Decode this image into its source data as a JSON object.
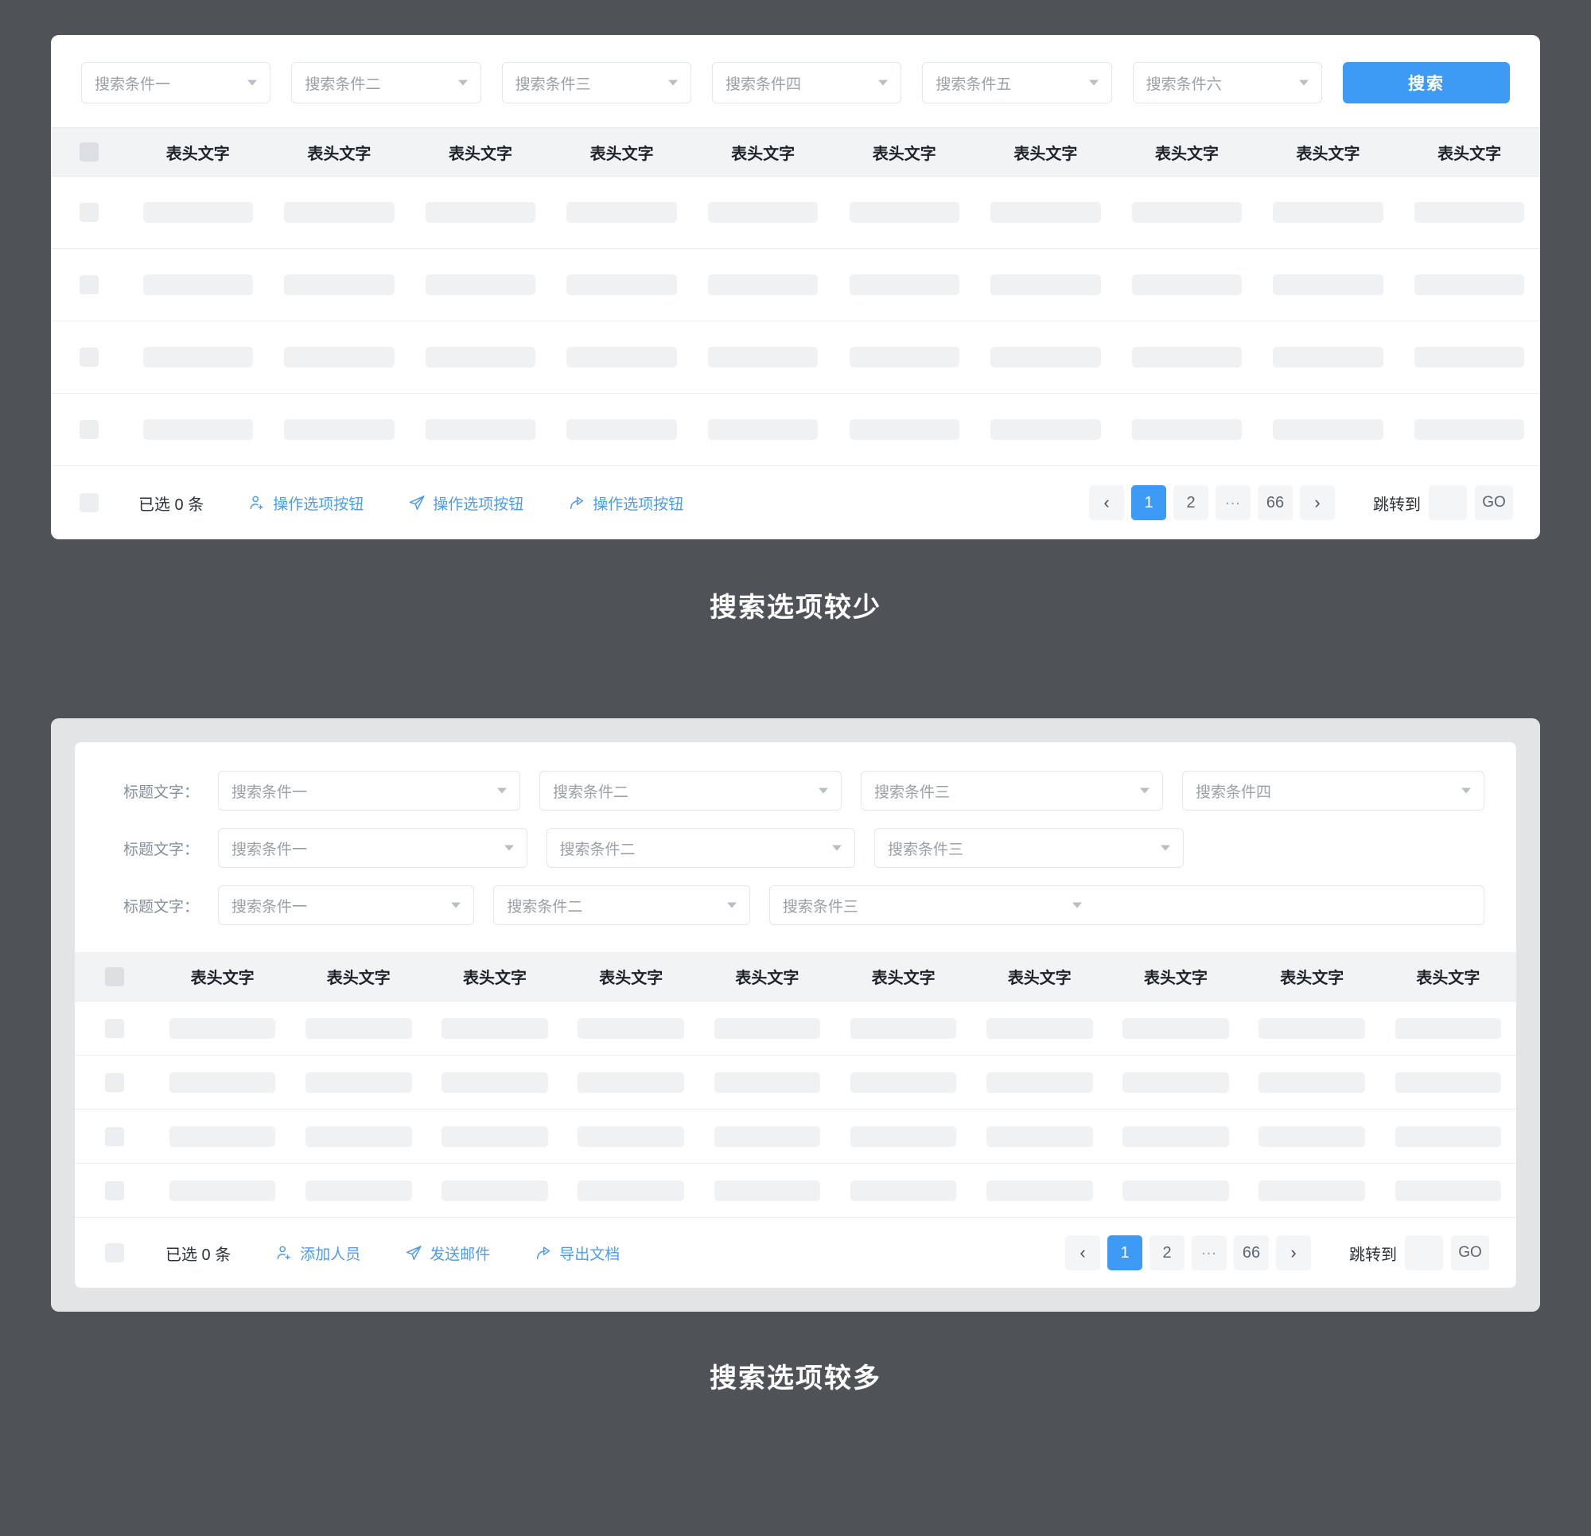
{
  "theme": {
    "page_bg": "#4f5358",
    "accent": "#3d9bf6",
    "link": "#4b9cf0",
    "header_bg": "#f2f3f5",
    "skeleton": "#f0f1f2"
  },
  "card_one": {
    "search_bar": {
      "selects": [
        {
          "value": "搜索条件一"
        },
        {
          "value": "搜索条件二"
        },
        {
          "value": "搜索条件三"
        },
        {
          "value": "搜索条件四"
        },
        {
          "value": "搜索条件五"
        },
        {
          "value": "搜索条件六"
        }
      ],
      "search_button": "搜索"
    },
    "table": {
      "headers": [
        "表头文字",
        "表头文字",
        "表头文字",
        "表头文字",
        "表头文字",
        "表头文字",
        "表头文字",
        "表头文字",
        "表头文字",
        "表头文字"
      ],
      "row_count": 4,
      "column_count": 10
    },
    "footer": {
      "selected_label": "已选 0 条",
      "actions": [
        {
          "icon": "user-add-icon",
          "label": "操作选项按钮"
        },
        {
          "icon": "send-icon",
          "label": "操作选项按钮"
        },
        {
          "icon": "share-icon",
          "label": "操作选项按钮"
        }
      ],
      "pagination": {
        "prev": "‹",
        "pages": [
          "1",
          "2",
          "...",
          "66"
        ],
        "active_page": "1",
        "next": "›",
        "jump_label": "跳转到",
        "jump_value": "",
        "go_label": "GO"
      }
    },
    "caption": "搜索选项较少"
  },
  "card_two": {
    "form": {
      "rows": [
        {
          "label": "标题文字：",
          "selects": [
            {
              "value": "搜索条件一",
              "width": "u1"
            },
            {
              "value": "搜索条件二",
              "width": "u1"
            },
            {
              "value": "搜索条件三",
              "width": "u1"
            },
            {
              "value": "搜索条件四",
              "width": "u1"
            }
          ],
          "spacers": 0
        },
        {
          "label": "标题文字：",
          "selects": [
            {
              "value": "搜索条件一",
              "width": "u1"
            },
            {
              "value": "搜索条件二",
              "width": "u1"
            },
            {
              "value": "搜索条件三",
              "width": "u1"
            }
          ],
          "spacers": 1
        },
        {
          "label": "标题文字：",
          "selects": [
            {
              "value": "搜索条件一",
              "width": "u1"
            },
            {
              "value": "搜索条件二",
              "width": "u1"
            },
            {
              "value": "搜索条件三",
              "width": "wide"
            }
          ],
          "spacers": 0
        }
      ]
    },
    "table": {
      "headers": [
        "表头文字",
        "表头文字",
        "表头文字",
        "表头文字",
        "表头文字",
        "表头文字",
        "表头文字",
        "表头文字",
        "表头文字",
        "表头文字"
      ],
      "row_count": 4,
      "column_count": 10
    },
    "footer": {
      "selected_label": "已选 0 条",
      "actions": [
        {
          "icon": "user-add-icon",
          "label": "添加人员"
        },
        {
          "icon": "send-icon",
          "label": "发送邮件"
        },
        {
          "icon": "share-icon",
          "label": "导出文档"
        }
      ],
      "pagination": {
        "prev": "‹",
        "pages": [
          "1",
          "2",
          "...",
          "66"
        ],
        "active_page": "1",
        "next": "›",
        "jump_label": "跳转到",
        "jump_value": "",
        "go_label": "GO"
      }
    },
    "caption": "搜索选项较多"
  }
}
